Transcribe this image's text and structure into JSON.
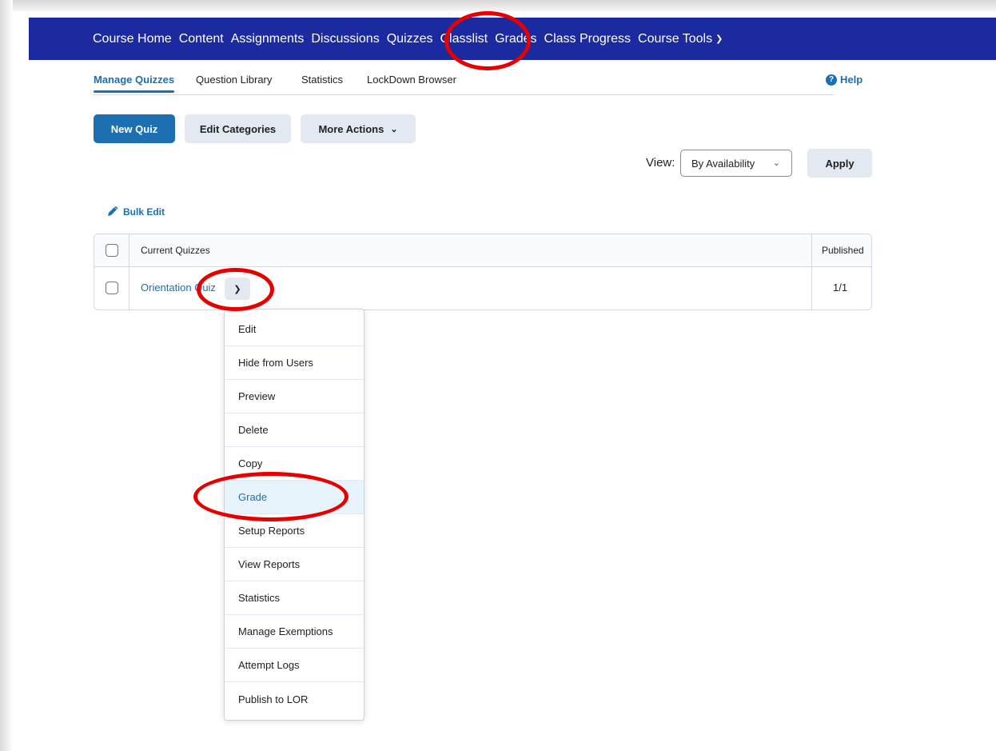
{
  "nav": {
    "items": [
      "Course Home",
      "Content",
      "Assignments",
      "Discussions",
      "Quizzes",
      "Classlist",
      "Grades",
      "Class Progress",
      "Course Tools"
    ]
  },
  "subtabs": [
    "Manage Quizzes",
    "Question Library",
    "Statistics",
    "LockDown Browser"
  ],
  "help": "Help",
  "buttons": {
    "new_quiz": "New Quiz",
    "edit_categories": "Edit Categories",
    "more_actions": "More Actions",
    "apply": "Apply"
  },
  "view": {
    "label": "View:",
    "selected": "By Availability"
  },
  "bulk_edit": "Bulk Edit",
  "table": {
    "headers": {
      "title": "Current Quizzes",
      "published": "Published"
    },
    "rows": [
      {
        "name": "Orientation Quiz",
        "published": "1/1"
      }
    ]
  },
  "context_menu": {
    "items": [
      "Edit",
      "Hide from Users",
      "Preview",
      "Delete",
      "Copy",
      "Grade",
      "Setup Reports",
      "View Reports",
      "Statistics",
      "Manage Exemptions",
      "Attempt Logs",
      "Publish to LOR"
    ],
    "highlighted": "Grade"
  },
  "colors": {
    "navbar": "#1b2a9e",
    "primary": "#1c6fb0",
    "annotation": "#e60000"
  }
}
